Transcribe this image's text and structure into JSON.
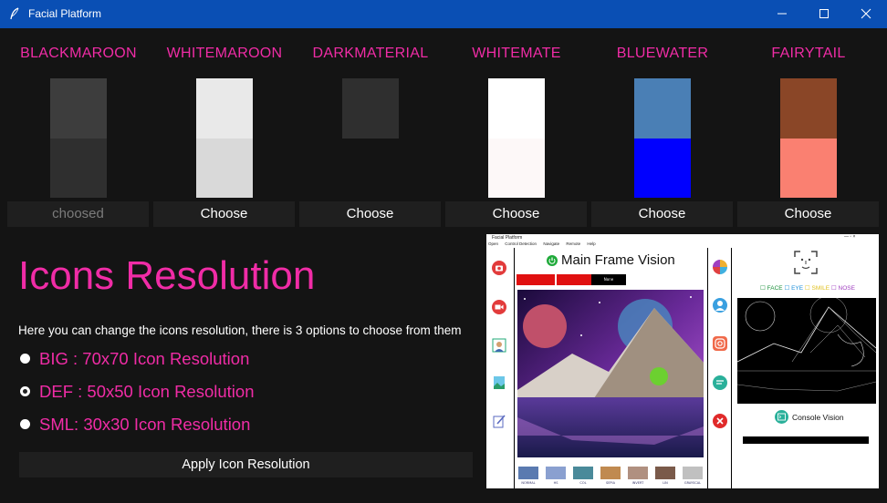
{
  "window": {
    "title": "Facial Platform",
    "minimize_glyph": "—",
    "maximize_glyph": "☐",
    "close_glyph": "✕"
  },
  "themes": [
    {
      "name": "BLACKMAROON",
      "top_color": "#3d3d3d",
      "bottom_color": "#2f2f2f",
      "button": "choosed"
    },
    {
      "name": "WHITEMAROON",
      "top_color": "#e9e9e9",
      "bottom_color": "#d9d9d9",
      "button": "Choose"
    },
    {
      "name": "DARKMATERIAL",
      "top_color": "#2f2f2f",
      "bottom_color": "#141414",
      "button": "Choose"
    },
    {
      "name": "WHITEMATE",
      "top_color": "#ffffff",
      "bottom_color": "#fdf8f8",
      "button": "Choose"
    },
    {
      "name": "BLUEWATER",
      "top_color": "#4a7fb5",
      "bottom_color": "#0000ff",
      "button": "Choose"
    },
    {
      "name": "FAIRYTAIL",
      "top_color": "#8a4627",
      "bottom_color": "#fa8071",
      "button": "Choose"
    }
  ],
  "icons": {
    "heading": "Icons Resolution",
    "description": "Here you can change the icons resolution, there is 3 options to choose from them",
    "options": [
      {
        "label": "BIG : 70x70 Icon Resolution",
        "checked": false
      },
      {
        "label": "DEF : 50x50 Icon Resolution",
        "checked": true
      },
      {
        "label": "SML: 30x30 Icon Resolution",
        "checked": false
      }
    ],
    "apply_label": "Apply Icon Resolution"
  },
  "preview": {
    "window_title": "Facial Platform",
    "menu": [
      "Open",
      "Control Detection",
      "Navigate",
      "Remote",
      "Help"
    ],
    "main_title": "Main Frame Vision",
    "pills": [
      "",
      "",
      "None"
    ],
    "checks": [
      {
        "label": "FACE",
        "color": "#1a8f3a"
      },
      {
        "label": "EYE",
        "color": "#1e8fd8"
      },
      {
        "label": "SMILE",
        "color": "#e0c020"
      },
      {
        "label": "NOSE",
        "color": "#a040c0"
      }
    ],
    "console_label": "Console Vision",
    "thumb_labels": [
      "NORMAL",
      "HS",
      "COL",
      "SEPIA",
      "INVERT",
      "LIN",
      "GRAYSCAL"
    ]
  },
  "colors": {
    "accent": "#f02ca6",
    "background": "#141414",
    "titlebar": "#0a4fb4",
    "button_bg": "#1f1f1f"
  }
}
